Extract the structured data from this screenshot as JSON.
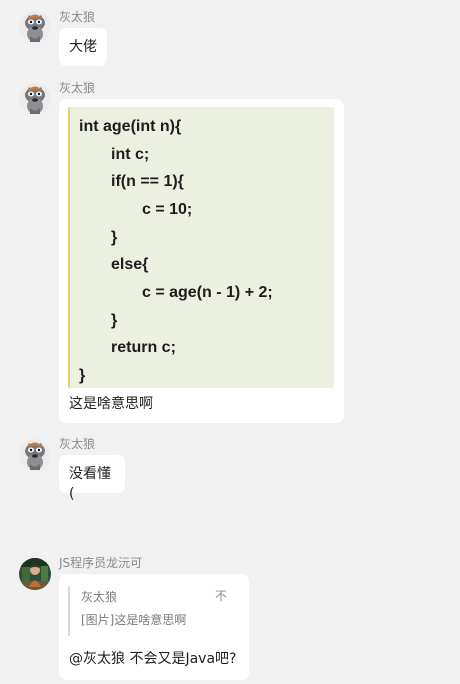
{
  "messages": [
    {
      "sender": "灰太狼",
      "text": "大佬"
    },
    {
      "sender": "灰太狼",
      "code_lines": [
        "int age(int n){",
        "int c;",
        "if(n == 1){",
        "c = 10;",
        "}",
        "else{",
        "c = age(n - 1) + 2;",
        "}",
        "return c;",
        "}"
      ],
      "text": "这是啥意思啊"
    },
    {
      "sender": "灰太狼",
      "text": "没看懂("
    },
    {
      "sender": "JS程序员龙沅可",
      "quote": {
        "name": "灰太狼",
        "text": "[图片]这是啥意思啊",
        "close_label": "不"
      },
      "text": "@灰太狼 不会又是Java吧?"
    }
  ],
  "colors": {
    "background": "#f1f1f1",
    "bubble": "#ffffff",
    "code_background": "#ebf0e1",
    "code_accent": "#e9cf63",
    "meta_text": "#8a8a8a"
  },
  "icons": {
    "grey_wolf_avatar": "grey-wolf-avatar-icon",
    "js_avatar": "js-programmer-avatar-icon"
  }
}
